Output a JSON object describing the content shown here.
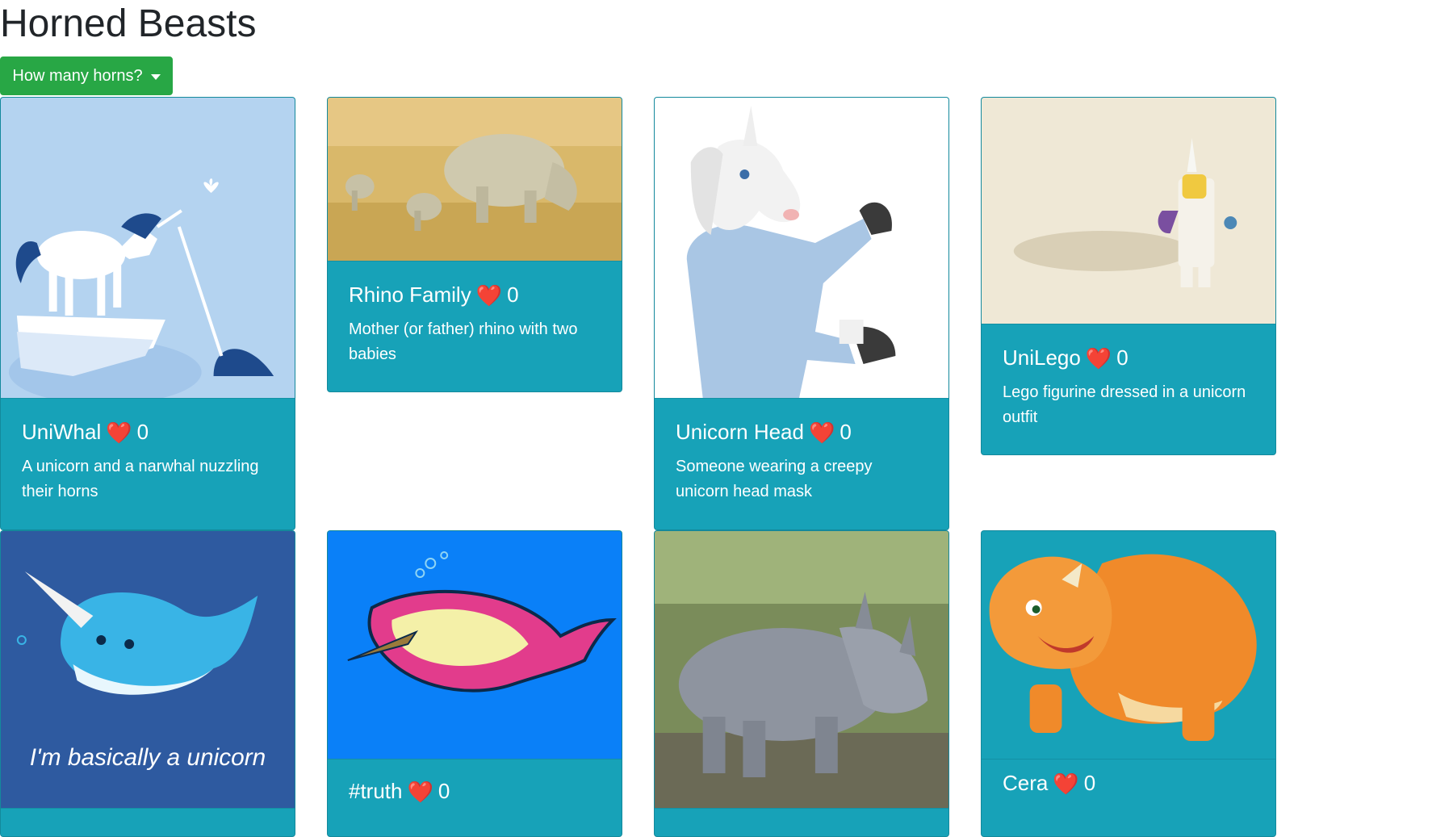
{
  "header": {
    "title": "Horned Beasts"
  },
  "filter": {
    "label": "How many horns?"
  },
  "heart_icon": "heart-icon",
  "beasts": [
    {
      "title": "UniWhal",
      "votes": "0",
      "description": "A unicorn and a narwhal nuzzling their horns"
    },
    {
      "title": "Rhino Family",
      "votes": "0",
      "description": "Mother (or father) rhino with two babies"
    },
    {
      "title": "Unicorn Head",
      "votes": "0",
      "description": "Someone wearing a creepy unicorn head mask"
    },
    {
      "title": "UniLego",
      "votes": "0",
      "description": "Lego figurine dressed in a unicorn outfit"
    },
    {
      "title": "",
      "votes": "",
      "description": "",
      "image_caption": "I'm basically a unicorn"
    },
    {
      "title": "#truth",
      "votes": "0",
      "description": ""
    },
    {
      "title": "",
      "votes": "",
      "description": ""
    },
    {
      "title": "Cera",
      "votes": "0",
      "description": ""
    }
  ],
  "colors": {
    "card_bg": "#17a2b8",
    "button_green": "#28a745",
    "heart_red": "#e0102c"
  }
}
